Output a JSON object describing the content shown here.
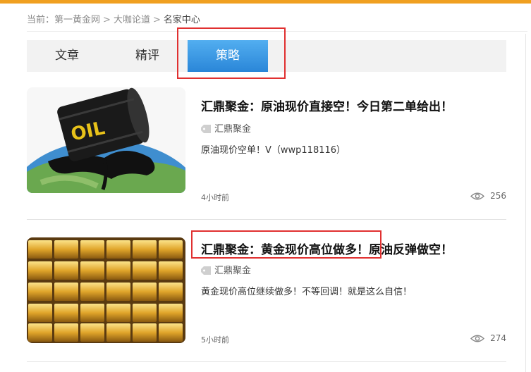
{
  "breadcrumb": {
    "prefix": "当前：",
    "items": [
      "第一黄金网",
      "大咖论道",
      "名家中心"
    ],
    "separator": ">"
  },
  "tabs": [
    {
      "label": "文章",
      "active": false
    },
    {
      "label": "精评",
      "active": false
    },
    {
      "label": "策略",
      "active": true
    }
  ],
  "articles": [
    {
      "title": "汇鼎聚金：原油现价直接空！今日第二单给出！",
      "tag": "汇鼎聚金",
      "summary": "原油现价空单！V（wwp118116）",
      "time": "4小时前",
      "views": "256",
      "image_icon": "oil-barrel-globe"
    },
    {
      "title": "汇鼎聚金：黄金现价高位做多！原油反弹做空！",
      "tag": "汇鼎聚金",
      "summary": "黄金现价高位继续做多！不等回调！就是这么自信！",
      "time": "5小时前",
      "views": "274",
      "image_icon": "gold-bars"
    }
  ],
  "colors": {
    "accent_top": "#f0a020",
    "tab_active": "#2a86d8",
    "highlight_box": "#e03030"
  }
}
